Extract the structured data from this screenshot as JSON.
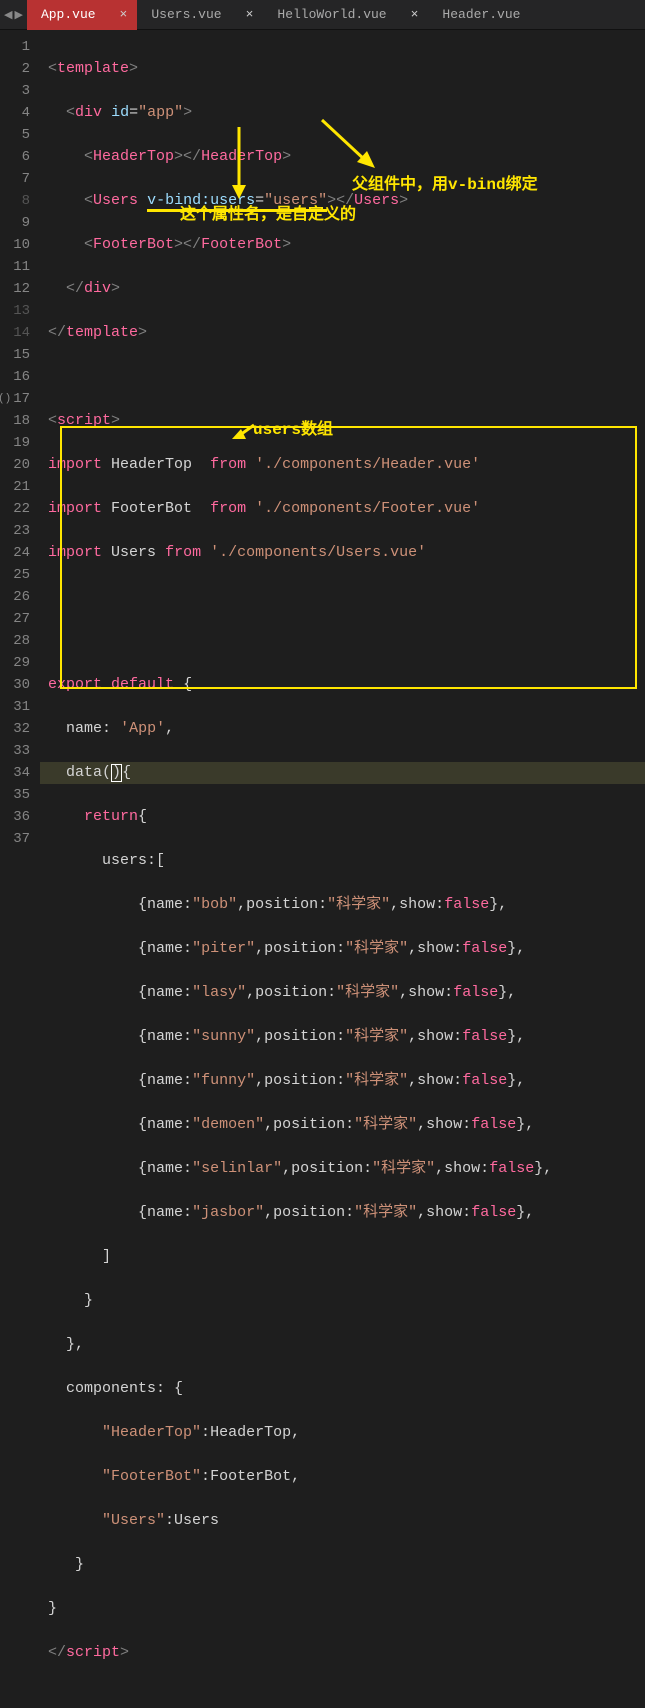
{
  "tabs": [
    {
      "label": "App.vue",
      "active": true
    },
    {
      "label": "Users.vue",
      "active": false
    },
    {
      "label": "HelloWorld.vue",
      "active": false
    },
    {
      "label": "Header.vue",
      "active": false
    }
  ],
  "annotations": {
    "box_label": "users数组",
    "right_label": "父组件中，用v-bind绑定",
    "left_label": "这个属性名，是自定义的"
  },
  "code": {
    "template_open": "template",
    "div": "div",
    "id_attr": "id",
    "id_val": "\"app\"",
    "HeaderTop": "HeaderTop",
    "Users": "Users",
    "vbind": "v-bind",
    "users_attr": ":users",
    "users_val": "\"users\"",
    "FooterBot": "FooterBot",
    "script": "script",
    "import": "import",
    "from": "from",
    "hdr_id": "HeaderTop",
    "hdr_path": "'./components/Header.vue'",
    "ftr_id": "FooterBot",
    "ftr_path": "'./components/Footer.vue'",
    "usr_id": "Users",
    "usr_path": "'./components/Users.vue'",
    "export": "export",
    "default": "default",
    "name_key": "name",
    "name_val": "'App'",
    "data": "data",
    "return": "return",
    "users_key": "users",
    "components": "components",
    "ht_key": "\"HeaderTop\"",
    "fb_key": "\"FooterBot\"",
    "us_key": "\"Users\"",
    "nm": "name",
    "pos": "position",
    "sh": "show",
    "fls": "false",
    "sci": "\"科学家\"",
    "n0": "\"bob\"",
    "n1": "\"piter\"",
    "n2": "\"lasy\"",
    "n3": "\"sunny\"",
    "n4": "\"funny\"",
    "n5": "\"demoen\"",
    "n6": "\"selinlar\"",
    "n7": "\"jasbor\""
  }
}
